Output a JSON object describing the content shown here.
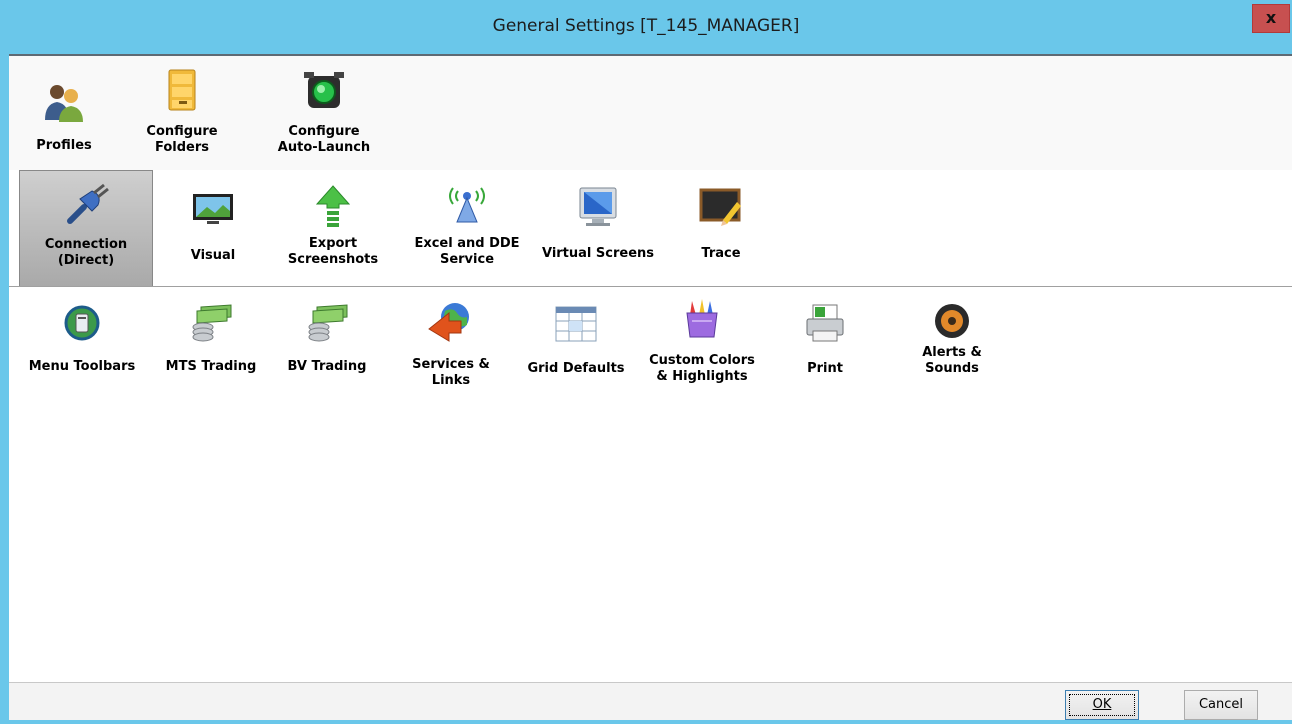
{
  "window": {
    "title": "General Settings [T_145_MANAGER]",
    "close_glyph": "x"
  },
  "rows": [
    {
      "items": [
        {
          "label": "Profiles",
          "icon": "profiles-icon"
        },
        {
          "label": "Configure\nFolders",
          "icon": "folder-cabinet-icon"
        },
        {
          "label": "Configure\nAuto-Launch",
          "icon": "traffic-light-icon"
        }
      ]
    },
    {
      "items": [
        {
          "label": "Connection\n(Direct)",
          "icon": "plug-icon",
          "selected": true
        },
        {
          "label": "Visual",
          "icon": "monitor-icon"
        },
        {
          "label": "Export\nScreenshots",
          "icon": "export-arrow-icon"
        },
        {
          "label": "Excel and DDE\nService",
          "icon": "antenna-icon"
        },
        {
          "label": "Virtual Screens",
          "icon": "virtual-screen-icon"
        },
        {
          "label": "Trace",
          "icon": "chalkboard-icon"
        }
      ]
    },
    {
      "items": [
        {
          "label": "Menu Toolbars",
          "icon": "menu-toolbars-icon"
        },
        {
          "label": "MTS Trading",
          "icon": "money-stack-icon"
        },
        {
          "label": "BV Trading",
          "icon": "money-stack-icon"
        },
        {
          "label": "Services &\nLinks",
          "icon": "globe-arrow-icon"
        },
        {
          "label": "Grid Defaults",
          "icon": "grid-icon"
        },
        {
          "label": "Custom Colors\n& Highlights",
          "icon": "crayons-icon"
        },
        {
          "label": "Print",
          "icon": "printer-icon"
        },
        {
          "label": "Alerts &\nSounds",
          "icon": "speaker-icon"
        }
      ]
    }
  ],
  "buttons": {
    "ok": "OK",
    "cancel": "Cancel"
  },
  "colors": {
    "titlebar": "#6ac7ea",
    "close": "#c75050",
    "selected_tile": "#b9b9b9"
  }
}
